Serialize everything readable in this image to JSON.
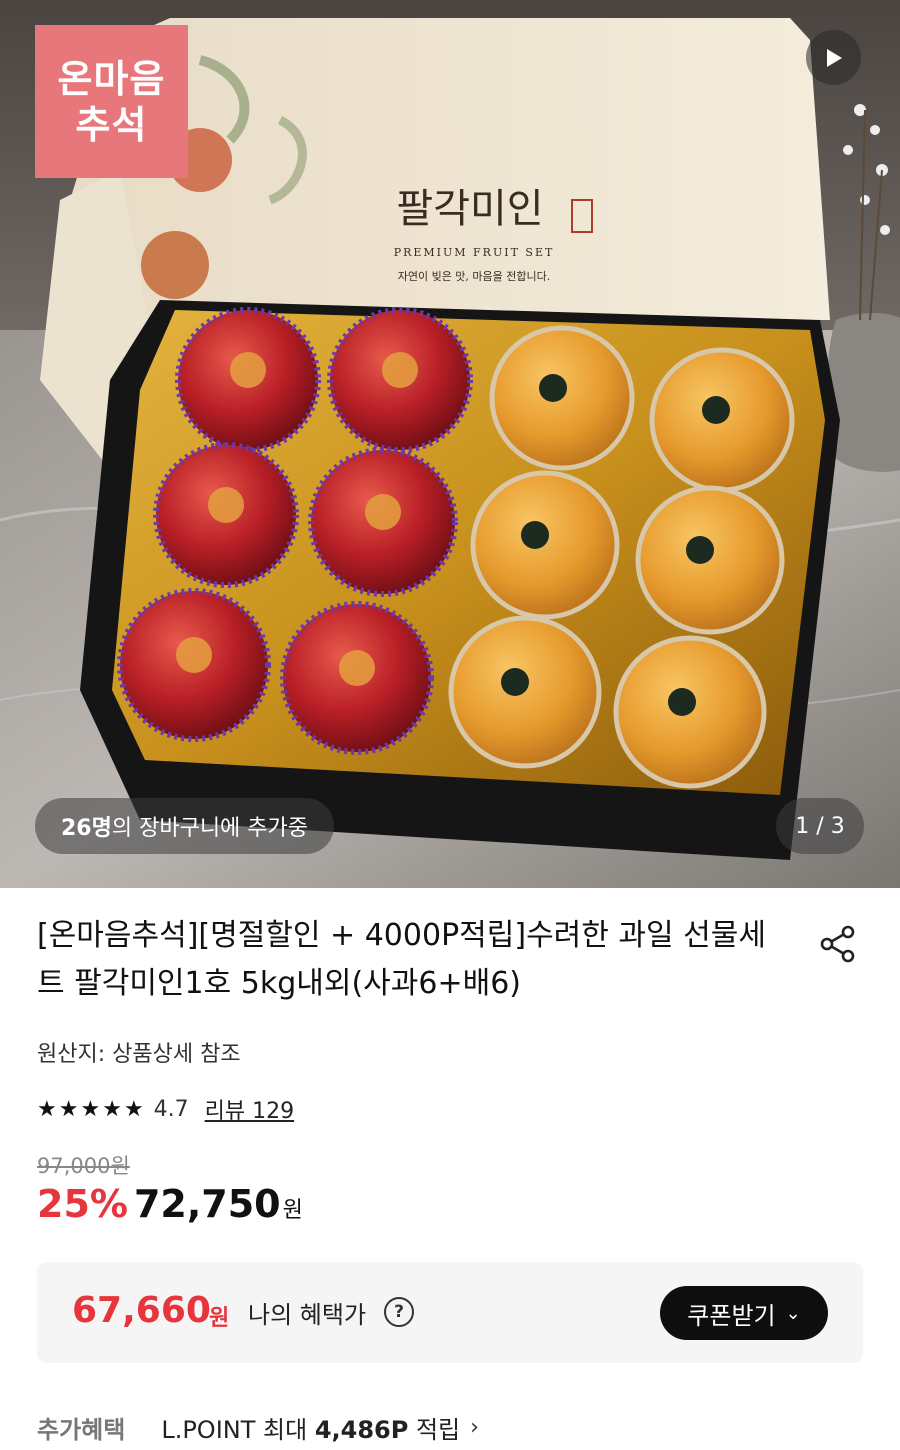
{
  "hero": {
    "badge_line1": "온마음",
    "badge_line2": "추석",
    "box_title": "팔각미인",
    "box_subtitle": "PREMIUM FRUIT SET",
    "box_tagline": "자연이 빚은 맛, 마음을 전합니다.",
    "cart_count": "26명",
    "cart_text": "의 장바구니에 추가중",
    "page_indicator": "1 / 3",
    "icons": [
      "play-icon"
    ]
  },
  "product": {
    "title": "[온마음추석][명절할인 + 4000P적립]수려한 과일 선물세트 팔각미인1호 5kg내외(사과6+배6)",
    "origin": "원산지: 상품상세 참조",
    "rating": "4.7",
    "rating_stars": 4.7,
    "review_link": "리뷰 129",
    "original_price": "97,000원",
    "discount": "25%",
    "price": "72,750",
    "price_unit": "원"
  },
  "benefit": {
    "price": "67,660",
    "price_unit": "원",
    "label": "나의 혜택가",
    "coupon_button": "쿠폰받기"
  },
  "extra": {
    "label": "추가혜택",
    "text_prefix": "L.POINT 최대 ",
    "points": "4,486P",
    "text_suffix": " 적립"
  },
  "colors": {
    "accent_red": "#e7353d",
    "badge_pink": "#e8777b",
    "button_black": "#0e0e0e"
  }
}
